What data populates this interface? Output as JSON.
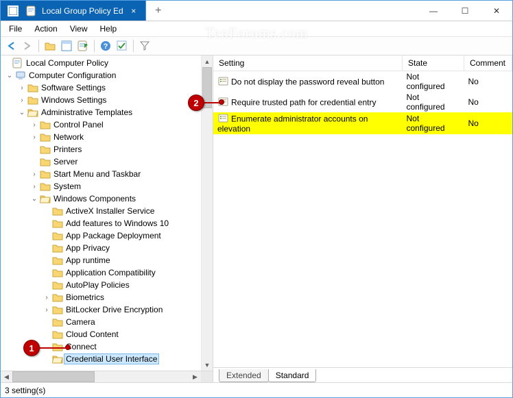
{
  "title": "Local Group Policy Ed",
  "watermark": "TenForums.com",
  "menubar": [
    "File",
    "Action",
    "View",
    "Help"
  ],
  "tree": {
    "root": "Local Computer Policy",
    "cc": "Computer Configuration",
    "ss": "Software Settings",
    "ws": "Windows Settings",
    "at": "Administrative Templates",
    "cp": "Control Panel",
    "nw": "Network",
    "pr": "Printers",
    "sv": "Server",
    "sm": "Start Menu and Taskbar",
    "sy": "System",
    "wc": "Windows Components",
    "items": [
      "ActiveX Installer Service",
      "Add features to Windows 10",
      "App Package Deployment",
      "App Privacy",
      "App runtime",
      "Application Compatibility",
      "AutoPlay Policies",
      "Biometrics",
      "BitLocker Drive Encryption",
      "Camera",
      "Cloud Content",
      "Connect",
      "Credential User Interface"
    ]
  },
  "columns": {
    "setting": "Setting",
    "state": "State",
    "comment": "Comment"
  },
  "rows": [
    {
      "s": "Do not display the password reveal button",
      "st": "Not configured",
      "c": "No",
      "hl": false
    },
    {
      "s": "Require trusted path for credential entry",
      "st": "Not configured",
      "c": "No",
      "hl": false
    },
    {
      "s": "Enumerate administrator accounts on elevation",
      "st": "Not configured",
      "c": "No",
      "hl": true
    }
  ],
  "tabs": {
    "ext": "Extended",
    "std": "Standard"
  },
  "status": "3 setting(s)"
}
